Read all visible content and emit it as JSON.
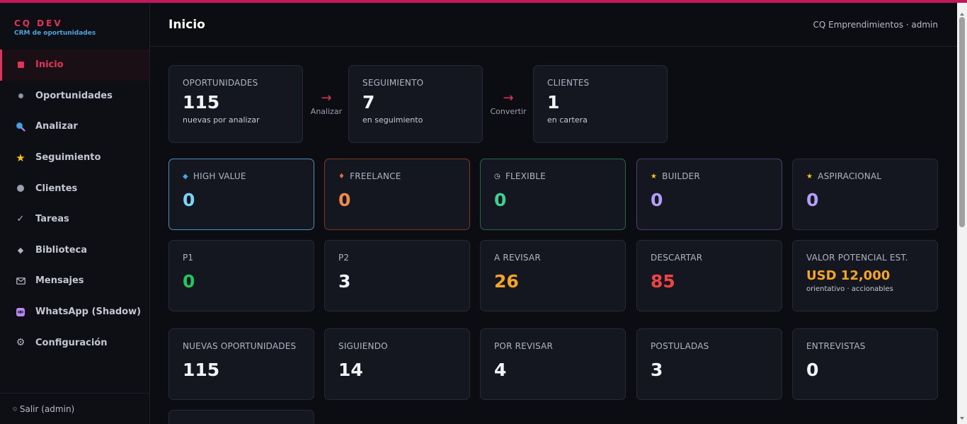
{
  "brand": {
    "name": "CQ DEV",
    "subtitle": "CRM de oportunidades"
  },
  "sidebar": {
    "items": [
      {
        "label": "Inicio",
        "icon": "square-icon",
        "active": true
      },
      {
        "label": "Oportunidades",
        "icon": "dot-icon"
      },
      {
        "label": "Analizar",
        "icon": "magnifier-icon"
      },
      {
        "label": "Seguimiento",
        "icon": "star-icon"
      },
      {
        "label": "Clientes",
        "icon": "circle-icon"
      },
      {
        "label": "Tareas",
        "icon": "check-icon"
      },
      {
        "label": "Biblioteca",
        "icon": "diamond-icon"
      },
      {
        "label": "Mensajes",
        "icon": "envelope-icon"
      },
      {
        "label": "WhatsApp (Shadow)",
        "icon": "shadow-icon"
      },
      {
        "label": "Configuración",
        "icon": "gear-icon"
      }
    ],
    "footer": "Salir (admin)"
  },
  "header": {
    "title": "Inicio",
    "user": "CQ Emprendimientos · admin"
  },
  "pipeline": [
    {
      "label": "OPORTUNIDADES",
      "value": "115",
      "sub": "nuevas por analizar"
    },
    {
      "label": "SEGUIMIENTO",
      "value": "7",
      "sub": "en seguimiento"
    },
    {
      "label": "CLIENTES",
      "value": "1",
      "sub": "en cartera"
    }
  ],
  "arrows": [
    "Analizar",
    "Convertir"
  ],
  "segments": [
    {
      "label": "HIGH VALUE",
      "value": "0",
      "icon": "gem-icon",
      "color": "#7dd3f5"
    },
    {
      "label": "FREELANCE",
      "value": "0",
      "icon": "fire-icon",
      "color": "#f08a4b"
    },
    {
      "label": "FLEXIBLE",
      "value": "0",
      "icon": "clock-icon",
      "color": "#3fcf8e"
    },
    {
      "label": "BUILDER",
      "value": "0",
      "icon": "star-icon",
      "color": "#b39df8"
    },
    {
      "label": "ASPIRACIONAL",
      "value": "0",
      "icon": "star-icon",
      "color": "#b39df8"
    }
  ],
  "priorities": [
    {
      "label": "P1",
      "value": "0",
      "color": "#22c55e"
    },
    {
      "label": "P2",
      "value": "3",
      "color": "#f3f4f7"
    },
    {
      "label": "A REVISAR",
      "value": "26",
      "color": "#f5a524"
    },
    {
      "label": "DESCARTAR",
      "value": "85",
      "color": "#ef4444"
    },
    {
      "label": "VALOR POTENCIAL EST.",
      "value": "USD 12,000",
      "sub": "orientativo · accionables",
      "color": "#f5a524"
    }
  ],
  "stats": [
    {
      "label": "NUEVAS OPORTUNIDADES",
      "value": "115"
    },
    {
      "label": "SIGUIENDO",
      "value": "14"
    },
    {
      "label": "POR REVISAR",
      "value": "4"
    },
    {
      "label": "POSTULADAS",
      "value": "3"
    },
    {
      "label": "ENTREVISTAS",
      "value": "0"
    }
  ]
}
